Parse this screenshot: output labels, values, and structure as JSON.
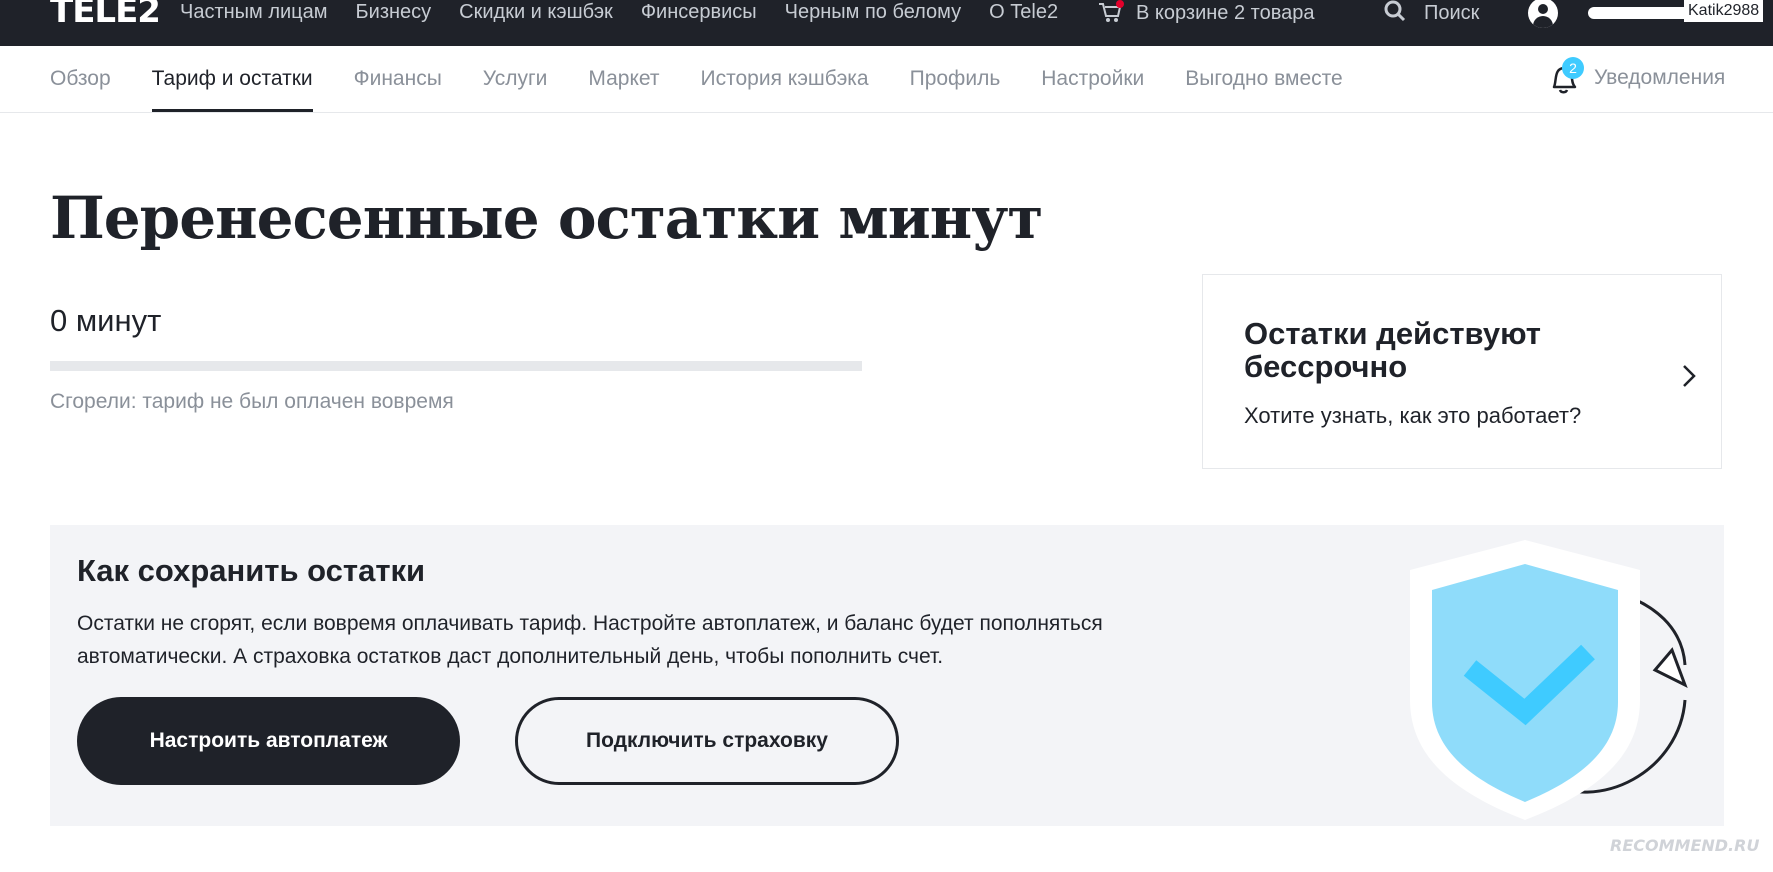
{
  "header": {
    "logo_text": "TELE2",
    "nav": [
      "Частным лицам",
      "Бизнесу",
      "Скидки и кэшбэк",
      "Финсервисы",
      "Черным по белому",
      "О Tele2"
    ],
    "cart_label": "В корзине 2 товара",
    "search_label": "Поиск",
    "user_name": "Katik2988"
  },
  "subnav": {
    "tabs": [
      {
        "label": "Обзор",
        "active": false
      },
      {
        "label": "Тариф и остатки",
        "active": true
      },
      {
        "label": "Финансы",
        "active": false
      },
      {
        "label": "Услуги",
        "active": false
      },
      {
        "label": "Маркет",
        "active": false
      },
      {
        "label": "История кэшбэка",
        "active": false
      },
      {
        "label": "Профиль",
        "active": false
      },
      {
        "label": "Настройки",
        "active": false
      },
      {
        "label": "Выгодно вместе",
        "active": false
      }
    ],
    "notifications_label": "Уведомления",
    "notifications_count": "2"
  },
  "main": {
    "title": "Перенесенные остатки минут",
    "minutes_value": "0 минут",
    "progress_fraction": 0,
    "burned_note": "Сгорели: тариф не был оплачен вовремя"
  },
  "info_card": {
    "title": "Остатки действуют бессрочно",
    "subtitle": "Хотите узнать, как это работает?"
  },
  "save_section": {
    "title": "Как сохранить остатки",
    "text": "Остатки не сгорят, если вовремя оплачивать тариф. Настройте автоплатеж, и баланс будет пополняться автоматически. А страховка остатков даст дополнительный день, чтобы пополнить счет.",
    "primary_button": "Настроить автоплатеж",
    "secondary_button": "Подключить страховку"
  },
  "watermark": "RECOMMEND.RU",
  "colors": {
    "dark": "#1f2229",
    "accent_blue": "#3fcbff",
    "shield_light": "#8fdcfa",
    "cart_dot": "#e4002b",
    "muted": "#8a9099",
    "section_bg": "#f3f4f7"
  }
}
